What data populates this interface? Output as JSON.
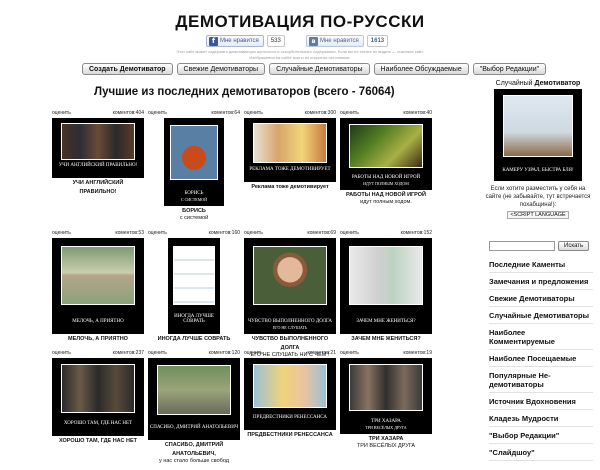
{
  "header": {
    "title": "ДЕМОТИВАЦИЯ ПО-РУССКИ",
    "tiny_line_1": "Этот сайт может содержать демотиваторы шуточного и оскорбительного содержания. Если вы не хотите их видеть — покиньте сайт.",
    "tiny_line_2": "Изображения на сайте взяты из открытых источников."
  },
  "social": {
    "fb": {
      "logo": "f",
      "label": "Мне нравится",
      "count": "533"
    },
    "vk": {
      "logo": "в",
      "label": "Мне нравится",
      "count": "1613"
    }
  },
  "nav": {
    "buttons": [
      {
        "label": "Создать Демотиватор"
      },
      {
        "label": "Свежие Демотиваторы"
      },
      {
        "label": "Случайные Демотиваторы"
      },
      {
        "label": "Наиболее Обсуждаемые"
      },
      {
        "label": "\"Выбор Редакции\""
      }
    ]
  },
  "section_title": "Лучшие из последних демотиваторов (всего - 76064)",
  "cards": [
    {
      "rate": "оценить",
      "comments": "коментов:404",
      "caption": "УЧИ АНГЛИЙСКИЙ ПРАВИЛЬНО!",
      "sub": "",
      "title": "УЧИ АНГЛИЙСКИЙ",
      "title2": "ПРАВИЛЬНО!",
      "text": ""
    },
    {
      "rate": "оценить",
      "comments": "коментов:64",
      "caption": "БОРИСЬ",
      "sub": "с системой",
      "title": "БОРИСЬ",
      "title2": "",
      "text": "с системой"
    },
    {
      "rate": "оценить",
      "comments": "коментов:300",
      "caption": "РЕКЛАМА ТОЖЕ ДЕМОТИВИРУЕТ",
      "sub": "",
      "title": "Реклама тоже демотивирует",
      "title2": "",
      "text": ""
    },
    {
      "rate": "оценить",
      "comments": "коментов:40",
      "caption": "РАБОТЫ НАД НОВОЙ ИГРОЙ",
      "sub": "идут полным ходом",
      "title": "РАБОТЫ НАД НОВОЙ ИГРОЙ",
      "title2": "",
      "text": "идут полным ходом."
    },
    {
      "rate": "оценить",
      "comments": "коментов:53",
      "caption": "МЕЛОЧЬ, А ПРИЯТНО",
      "sub": "",
      "title": "МЕЛОЧЬ, А ПРИЯТНО",
      "title2": "",
      "text": ""
    },
    {
      "rate": "оценить",
      "comments": "коментов:160",
      "caption": "ИНОГДА ЛУЧШЕ СОВРАТЬ",
      "sub": "",
      "title": "ИНОГДА ЛУЧШЕ СОВРАТЬ",
      "title2": "",
      "text": ""
    },
    {
      "rate": "оценить",
      "comments": "коментов:69",
      "caption": "ЧУВСТВО ВЫПОЛНЕННОГО ДОЛГА",
      "sub": "его не слушать",
      "title": "ЧУВСТВО ВЫПОЛНЕННОГО",
      "title2": "ДОЛГА",
      "text": "ЕГО НЕ СЛУШАТЬ НИ С ЧЕМ !"
    },
    {
      "rate": "оценить",
      "comments": "коментов:152",
      "caption": "ЗАЧЕМ МНЕ ЖЕНИТЬСЯ?",
      "sub": "",
      "title": "ЗАЧЕМ МНЕ ЖЕНИТЬСЯ?",
      "title2": "",
      "text": ""
    },
    {
      "rate": "оценить",
      "comments": "коментов:237",
      "caption": "ХОРОШО ТАМ, ГДЕ НАС НЕТ",
      "sub": "",
      "title": "ХОРОШО ТАМ, ГДЕ НАС НЕТ",
      "title2": "",
      "text": ""
    },
    {
      "rate": "оценить",
      "comments": "коментов:120",
      "caption": "СПАСИБО, ДМИТРИЙ АНАТОЛЬЕВИЧ",
      "sub": "",
      "title": "СПАСИБО, ДМИТРИЙ",
      "title2": "АНАТОЛЬЕВИЧ,",
      "text": "у нас стало больше свобод"
    },
    {
      "rate": "оценить",
      "comments": "коментов:21",
      "caption": "ПРЕДВЕСТНИКИ РЕНЕССАНСА",
      "sub": "",
      "title": "ПРЕДВЕСТНИКИ РЕНЕССАНСА",
      "title2": "",
      "text": ""
    },
    {
      "rate": "оценить",
      "comments": "коментов:19",
      "caption": "ТРИ ХАЗАРА",
      "sub": "три весёлых друга",
      "title": "ТРИ ХАЗАРА",
      "title2": "",
      "text": "ТРИ ВЕСЁЛЫХ ДРУГА"
    }
  ],
  "sidebar": {
    "random_label": "Случайный",
    "random_bold": "Демотиватор",
    "random_caption": "КАМЕРУ УЗРАЛ, БЫСТРА БЛЯ!",
    "note": "Если хотите разместить у себя на сайте (не забывайте, тут встречается похабщина!):",
    "script_tag": "<SCRIPT LANGUAGE",
    "search_button": "Искать",
    "menu": [
      "Последние Каменты",
      "Замечания и предложения",
      "Свежие Демотиваторы",
      "Случайные Демотиваторы",
      "Наиболее Комментируемые",
      "Наиболее Посещаемые",
      "Популярные Не-демотиваторы",
      "Источник Вдохновения",
      "Кладезь Мудрости",
      "\"Выбор Редакции\"",
      "\"Слайдшоу\""
    ]
  },
  "colors": {
    "frame": "#000000",
    "link": "#111111",
    "fb": "#3b5998",
    "vk": "#5b7fa6"
  }
}
